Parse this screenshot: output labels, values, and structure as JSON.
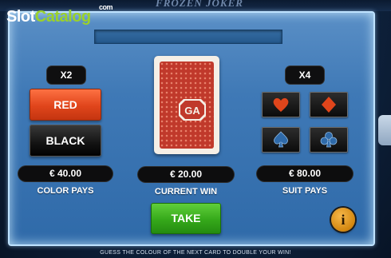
{
  "header": {
    "game_title": "FROZEN JOKER",
    "watermark": {
      "part1": "Slot",
      "part2": "Catalog",
      "suffix": "com"
    }
  },
  "message_bar": {
    "text": ""
  },
  "color_panel": {
    "multiplier": "X2",
    "red_label": "RED",
    "black_label": "BLACK",
    "pays_value": "€ 40.00",
    "pays_caption": "COLOR PAYS"
  },
  "card_panel": {
    "card_back_logo": "GA",
    "win_value": "€ 20.00",
    "win_caption": "CURRENT WIN",
    "take_label": "TAKE"
  },
  "suit_panel": {
    "multiplier": "X4",
    "suits": [
      {
        "name": "hearts",
        "color": "#e0451b"
      },
      {
        "name": "diamonds",
        "color": "#e0451b"
      },
      {
        "name": "spades",
        "color": "#2f6aa9"
      },
      {
        "name": "clubs",
        "color": "#2f6aa9"
      }
    ],
    "pays_value": "€ 80.00",
    "pays_caption": "SUIT PAYS"
  },
  "info_button": {
    "label": "i"
  },
  "instruction": "GUESS THE COLOUR OF THE NEXT CARD TO DOUBLE YOUR WIN!"
}
